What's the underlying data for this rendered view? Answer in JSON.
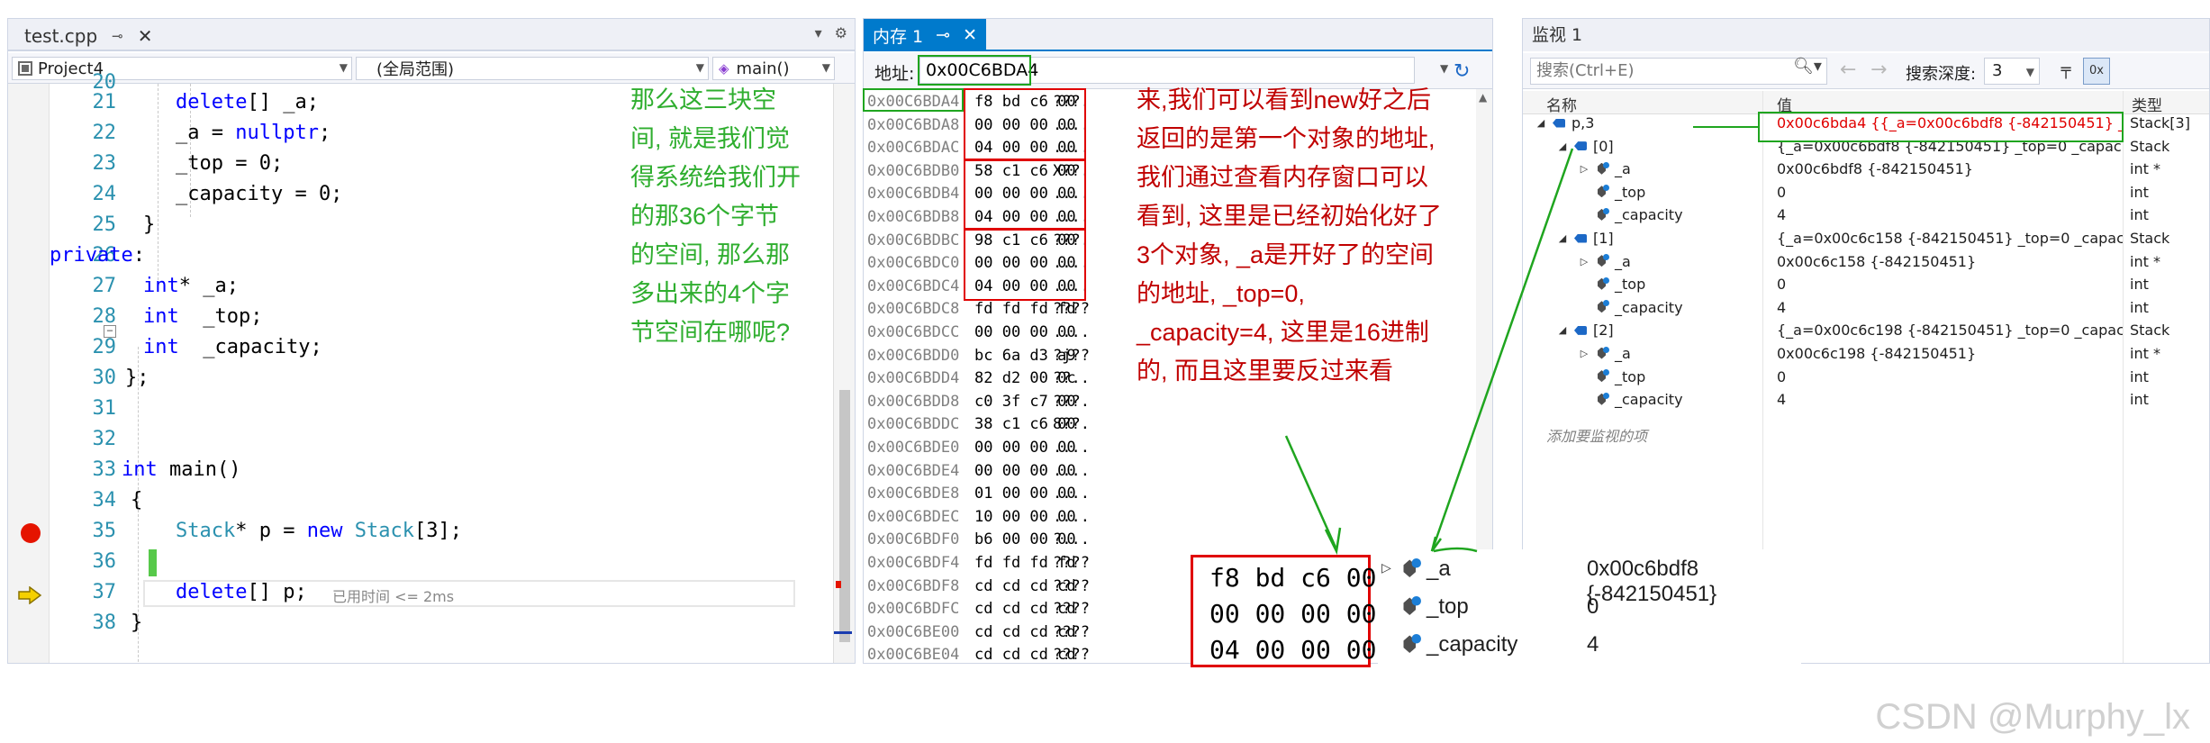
{
  "editor": {
    "tab": {
      "title": "test.cpp",
      "pin": "⊸",
      "close": "✕"
    },
    "right_icons": [
      "▾",
      "⚙"
    ],
    "nav": {
      "project": "Project4",
      "scope": "(全局范围)",
      "function": "main()"
    },
    "lines": [
      {
        "num": "20",
        "code": ""
      },
      {
        "num": "21",
        "code": "delete[] _a;"
      },
      {
        "num": "22",
        "code": "_a = nullptr;"
      },
      {
        "num": "23",
        "code": "_top = 0;"
      },
      {
        "num": "24",
        "code": "_capacity = 0;"
      },
      {
        "num": "25",
        "code": "}"
      },
      {
        "num": "26",
        "code": "private:"
      },
      {
        "num": "27",
        "code": "int* _a;"
      },
      {
        "num": "28",
        "code": "int  _top;"
      },
      {
        "num": "29",
        "code": "int  _capacity;"
      },
      {
        "num": "30",
        "code": "};"
      },
      {
        "num": "31",
        "code": ""
      },
      {
        "num": "32",
        "code": ""
      },
      {
        "num": "33",
        "code": "int main()"
      },
      {
        "num": "34",
        "code": "{"
      },
      {
        "num": "35",
        "code": "Stack* p = new Stack[3];"
      },
      {
        "num": "36",
        "code": ""
      },
      {
        "num": "37",
        "code": "delete[] p;"
      },
      {
        "num": "38",
        "code": "}"
      }
    ],
    "elapsed": "已用时间 <= 2ms"
  },
  "annotations": {
    "green_note": "那么这三块空\n间, 就是我们觉\n得系统给我们开\n的那36个字节\n的空间, 那么那\n多出来的4个字\n节空间在哪呢?",
    "red_note": "来,我们可以看到new好之后\n返回的是第一个对象的地址,\n我们通过查看内存窗口可以\n看到, 这里是已经初始化好了\n3个对象, _a是开好了的空间\n的地址, _top=0,\n_capacity=4, 这里是16进制\n的, 而且这里要反过来看"
  },
  "memory": {
    "tab": {
      "title": "内存 1",
      "pin": "⊸",
      "close": "✕"
    },
    "address_label": "地址:",
    "address_value": "0x00C6BDA4",
    "rows": [
      {
        "addr": "0x00C6BDA4",
        "bytes": "f8 bd c6 00",
        "ascii": "???."
      },
      {
        "addr": "0x00C6BDA8",
        "bytes": "00 00 00 00",
        "ascii": "...."
      },
      {
        "addr": "0x00C6BDAC",
        "bytes": "04 00 00 00",
        "ascii": "...."
      },
      {
        "addr": "0x00C6BDB0",
        "bytes": "58 c1 c6 00",
        "ascii": "X??."
      },
      {
        "addr": "0x00C6BDB4",
        "bytes": "00 00 00 00",
        "ascii": "...."
      },
      {
        "addr": "0x00C6BDB8",
        "bytes": "04 00 00 00",
        "ascii": "...."
      },
      {
        "addr": "0x00C6BDBC",
        "bytes": "98 c1 c6 00",
        "ascii": "???."
      },
      {
        "addr": "0x00C6BDC0",
        "bytes": "00 00 00 00",
        "ascii": "...."
      },
      {
        "addr": "0x00C6BDC4",
        "bytes": "04 00 00 00",
        "ascii": "...."
      },
      {
        "addr": "0x00C6BDC8",
        "bytes": "fd fd fd fd",
        "ascii": "????"
      },
      {
        "addr": "0x00C6BDCC",
        "bytes": "00 00 00 00",
        "ascii": "...."
      },
      {
        "addr": "0x00C6BDD0",
        "bytes": "bc 6a d3 a9",
        "ascii": "?j??"
      },
      {
        "addr": "0x00C6BDD4",
        "bytes": "82 d2 00 0c",
        "ascii": "??.."
      },
      {
        "addr": "0x00C6BDD8",
        "bytes": "c0 3f c7 00",
        "ascii": "???."
      },
      {
        "addr": "0x00C6BDDC",
        "bytes": "38 c1 c6 00",
        "ascii": "8??."
      },
      {
        "addr": "0x00C6BDE0",
        "bytes": "00 00 00 00",
        "ascii": "...."
      },
      {
        "addr": "0x00C6BDE4",
        "bytes": "00 00 00 00",
        "ascii": "...."
      },
      {
        "addr": "0x00C6BDE8",
        "bytes": "01 00 00 00",
        "ascii": "...."
      },
      {
        "addr": "0x00C6BDEC",
        "bytes": "10 00 00 00",
        "ascii": "...."
      },
      {
        "addr": "0x00C6BDF0",
        "bytes": "b6 00 00 00",
        "ascii": "?..."
      },
      {
        "addr": "0x00C6BDF4",
        "bytes": "fd fd fd fd",
        "ascii": "????"
      },
      {
        "addr": "0x00C6BDF8",
        "bytes": "cd cd cd cd",
        "ascii": "????"
      },
      {
        "addr": "0x00C6BDFC",
        "bytes": "cd cd cd cd",
        "ascii": "????"
      },
      {
        "addr": "0x00C6BE00",
        "bytes": "cd cd cd cd",
        "ascii": "????"
      },
      {
        "addr": "0x00C6BE04",
        "bytes": "cd cd cd cd",
        "ascii": "????"
      }
    ]
  },
  "watch": {
    "title": "监视 1",
    "search_placeholder": "搜索(Ctrl+E)",
    "search_depth_label": "搜索深度:",
    "search_depth": "3",
    "columns": {
      "name": "名称",
      "value": "值",
      "type": "类型"
    },
    "rows": [
      {
        "name": "p,3",
        "value": "0x00c6bda4 {{_a=0x00c6bdf8 {-842150451} _t...",
        "type": "Stack[3]"
      },
      {
        "name": "[0]",
        "value": "{_a=0x00c6bdf8 {-842150451} _top=0 _capacit...",
        "type": "Stack"
      },
      {
        "name": "_a",
        "value": "0x00c6bdf8 {-842150451}",
        "type": "int *"
      },
      {
        "name": "_top",
        "value": "0",
        "type": "int"
      },
      {
        "name": "_capacity",
        "value": "4",
        "type": "int"
      },
      {
        "name": "[1]",
        "value": "{_a=0x00c6c158 {-842150451} _top=0 _capacit...",
        "type": "Stack"
      },
      {
        "name": "_a",
        "value": "0x00c6c158 {-842150451}",
        "type": "int *"
      },
      {
        "name": "_top",
        "value": "0",
        "type": "int"
      },
      {
        "name": "_capacity",
        "value": "4",
        "type": "int"
      },
      {
        "name": "[2]",
        "value": "{_a=0x00c6c198 {-842150451} _top=0 _capacit...",
        "type": "Stack"
      },
      {
        "name": "_a",
        "value": "0x00c6c198 {-842150451}",
        "type": "int *"
      },
      {
        "name": "_top",
        "value": "0",
        "type": "int"
      },
      {
        "name": "_capacity",
        "value": "4",
        "type": "int"
      }
    ],
    "add_item": "添加要监视的项"
  },
  "zoom": {
    "bytes": [
      "f8 bd c6 00",
      "00 00 00 00",
      "04 00 00 00"
    ],
    "rows": [
      {
        "name": "_a",
        "value": "0x00c6bdf8 {-842150451}"
      },
      {
        "name": "_top",
        "value": "0"
      },
      {
        "name": "_capacity",
        "value": "4"
      }
    ]
  },
  "watermark": "CSDN @Murphy_lx",
  "colors": {
    "annotation_red": "#c00000",
    "annotation_green": "#2fae2f",
    "highlight_red": "#e00000",
    "accent": "#007acc",
    "breakpoint": "#e51400"
  }
}
